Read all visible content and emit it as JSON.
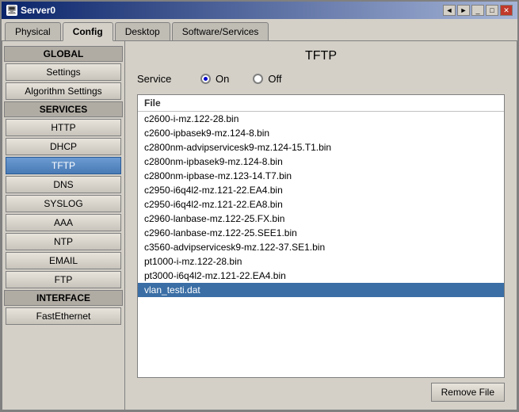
{
  "window": {
    "title": "Server0",
    "icon": "🖥"
  },
  "title_controls": {
    "back": "◄",
    "forward": "►",
    "minimize": "_",
    "maximize": "□",
    "close": "✕"
  },
  "tabs": [
    {
      "label": "Physical",
      "active": false
    },
    {
      "label": "Config",
      "active": true
    },
    {
      "label": "Desktop",
      "active": false
    },
    {
      "label": "Software/Services",
      "active": false
    }
  ],
  "sidebar": {
    "sections": [
      {
        "header": "GLOBAL",
        "items": [
          {
            "label": "Settings",
            "active": false
          },
          {
            "label": "Algorithm Settings",
            "active": false
          }
        ]
      },
      {
        "header": "SERVICES",
        "items": [
          {
            "label": "HTTP",
            "active": false
          },
          {
            "label": "DHCP",
            "active": false
          },
          {
            "label": "TFTP",
            "active": true
          },
          {
            "label": "DNS",
            "active": false
          },
          {
            "label": "SYSLOG",
            "active": false
          },
          {
            "label": "AAA",
            "active": false
          },
          {
            "label": "NTP",
            "active": false
          },
          {
            "label": "EMAIL",
            "active": false
          },
          {
            "label": "FTP",
            "active": false
          }
        ]
      },
      {
        "header": "INTERFACE",
        "items": [
          {
            "label": "FastEthernet",
            "active": false
          }
        ]
      }
    ]
  },
  "panel": {
    "title": "TFTP",
    "service_label": "Service",
    "radio_on": "On",
    "radio_off": "Off",
    "on_selected": true,
    "file_header": "File",
    "files": [
      "c2600-i-mz.122-28.bin",
      "c2600-ipbasek9-mz.124-8.bin",
      "c2800nm-advipservicesk9-mz.124-15.T1.bin",
      "c2800nm-ipbasek9-mz.124-8.bin",
      "c2800nm-ipbase-mz.123-14.T7.bin",
      "c2950-i6q4l2-mz.121-22.EA4.bin",
      "c2950-i6q4l2-mz.121-22.EA8.bin",
      "c2960-lanbase-mz.122-25.FX.bin",
      "c2960-lanbase-mz.122-25.SEE1.bin",
      "c3560-advipservicesk9-mz.122-37.SE1.bin",
      "pt1000-i-mz.122-28.bin",
      "pt3000-i6q4l2-mz.121-22.EA4.bin",
      "vlan_testi.dat"
    ],
    "selected_file": "vlan_testi.dat",
    "remove_button": "Remove File"
  }
}
